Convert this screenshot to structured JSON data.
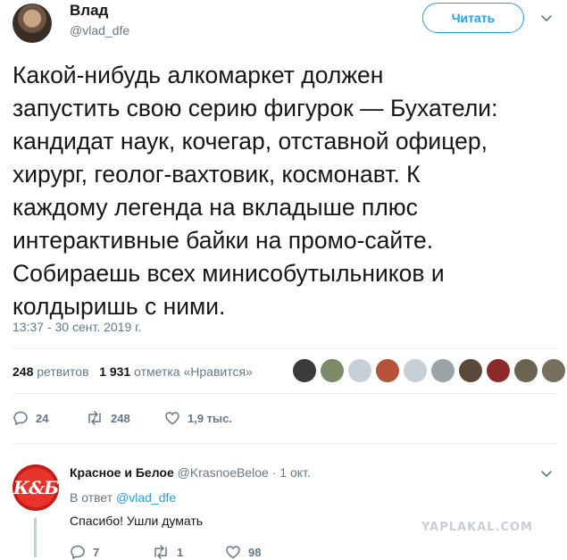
{
  "tweet": {
    "author_name": "Влад",
    "author_handle": "@vlad_dfe",
    "follow_label": "Читать",
    "text": "Какой-нибудь алкомаркет должен\nзапустить свою серию фигурок — Бухатели:\nкандидат наук, кочегар, отставной офицер,\nхирург, геолог-вахтовик, космонавт. К\nкаждому легенда на вкладыше плюс\nинтерактивные байки на промо-сайте.\nСобираешь всех минисобутыльников и\nколдыришь с ними.",
    "timestamp": "13:37 - 30 сент. 2019 г.",
    "retweets_count": "248",
    "retweets_label": "ретвитов",
    "likes_count": "1 931",
    "likes_label": "отметка «Нравится»",
    "liker_colors": [
      "#3b3b3b",
      "#7d8a6a",
      "#c5d0d8",
      "#b5523a",
      "#c5d0d8",
      "#9aa3a8",
      "#5a4a3e",
      "#8c2a2a",
      "#6b6250",
      "#77705f"
    ],
    "actions": {
      "replies": "24",
      "retweets": "248",
      "likes": "1,9 тыс."
    }
  },
  "reply": {
    "author_name": "Красное и Белое",
    "author_handle": "@KrasnoeBeloe",
    "separator": "·",
    "date": "1 окт.",
    "avatar_text": "К&Б",
    "in_reply_to_label": "В ответ",
    "in_reply_to_handle": "@vlad_dfe",
    "text": "Спасибо! Ушли думать",
    "actions": {
      "replies": "7",
      "retweets": "1",
      "likes": "98"
    }
  },
  "watermark": "YAPLAKAL.COM",
  "colors": {
    "accent": "#1da1f2",
    "text": "#14171a",
    "muted": "#657786",
    "divider": "#e6ecf0",
    "brand_red": "#e8342c"
  }
}
